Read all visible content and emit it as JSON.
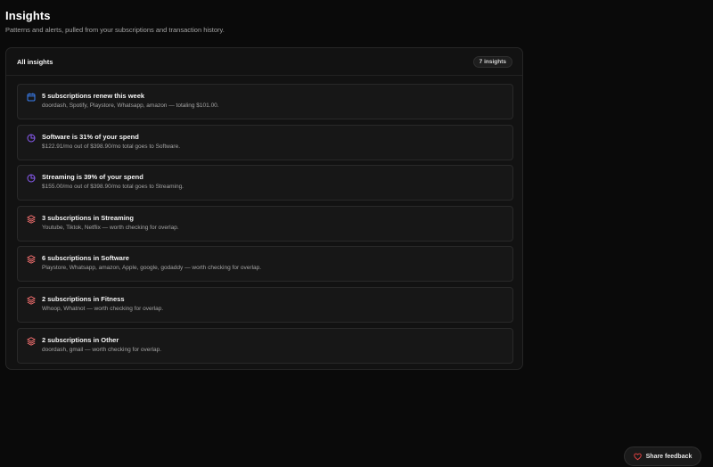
{
  "header": {
    "title": "Insights",
    "subtitle": "Patterns and alerts, pulled from your subscriptions and transaction history."
  },
  "panel": {
    "title": "All insights",
    "count_label": "7 insights"
  },
  "colors": {
    "calendar_icon": "#3b82f6",
    "pie_icon": "#8b5cf6",
    "layers_icon": "#f87171",
    "heart_icon": "#ef4444"
  },
  "insights": [
    {
      "icon": "calendar-icon",
      "title": "5 subscriptions renew this week",
      "desc": "doordash, Spotify, Playstore, Whatsapp, amazon — totaling $101.00."
    },
    {
      "icon": "pie-chart-icon",
      "title": "Software is 31% of your spend",
      "desc": "$122.91/mo out of $398.90/mo total goes to Software."
    },
    {
      "icon": "pie-chart-icon",
      "title": "Streaming is 39% of your spend",
      "desc": "$155.00/mo out of $398.90/mo total goes to Streaming."
    },
    {
      "icon": "layers-icon",
      "title": "3 subscriptions in Streaming",
      "desc": "Youtube, Tiktok, Netflix — worth checking for overlap."
    },
    {
      "icon": "layers-icon",
      "title": "6 subscriptions in Software",
      "desc": "Playstore, Whatsapp, amazon, Apple, google, godaddy — worth checking for overlap."
    },
    {
      "icon": "layers-icon",
      "title": "2 subscriptions in Fitness",
      "desc": "Whoop, Whatnot — worth checking for overlap."
    },
    {
      "icon": "layers-icon",
      "title": "2 subscriptions in Other",
      "desc": "doordash, gmail — worth checking for overlap."
    }
  ],
  "feedback": {
    "label": "Share feedback",
    "icon": "heart-icon"
  }
}
